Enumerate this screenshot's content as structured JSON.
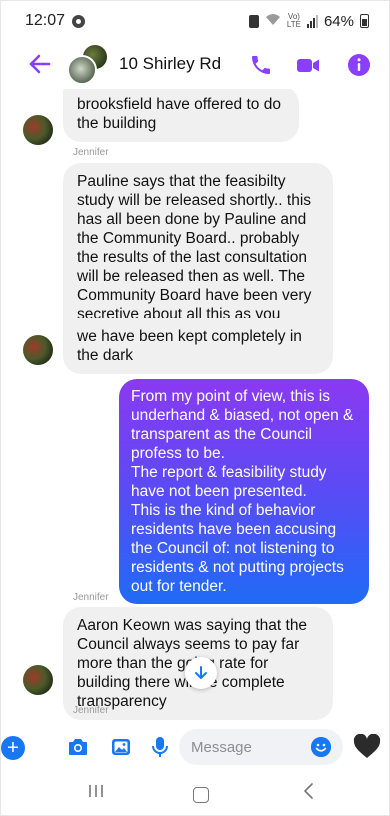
{
  "status_bar": {
    "time": "12:07",
    "lte_top": "Vo)",
    "lte_bottom": "LTE",
    "battery": "64%"
  },
  "header": {
    "title": "10 Shirley Rd",
    "back_icon": "arrow-left-icon",
    "actions": [
      "phone-icon",
      "video-icon",
      "info-icon"
    ],
    "accent_color": "#8a3ffc"
  },
  "messages": [
    {
      "id": "m1",
      "direction": "incoming",
      "text": "brooksfield have offered to do the building"
    },
    {
      "id": "m2",
      "direction": "incoming",
      "sender": "Jennifer",
      "text": "Pauline says that the feasibilty study will be released shortly.. this has all been done by Pauline and the Community Board.. probably the results of the last consultation will be released then as well. The Community Board have been very secretive about all this as you know?"
    },
    {
      "id": "m3",
      "direction": "incoming",
      "text": "we have been kept completely in the dark"
    },
    {
      "id": "m4",
      "direction": "outgoing",
      "lines": [
        "From my point of view, this is underhand & biased, not open & transparent as the Council profess to be.",
        "The report & feasibility study have not been presented.",
        "This is the kind of behavior residents have been accusing the Council of: not listening to residents & not putting projects out for tender."
      ]
    },
    {
      "id": "m5",
      "direction": "incoming",
      "sender": "Jennifer",
      "text": "Aaron Keown was saying that the Council always seems to pay far more than the going rate for building there will be complete transparency"
    },
    {
      "id": "m6",
      "sender": "Jennifer"
    }
  ],
  "composer": {
    "placeholder": "Message",
    "icons": [
      "plus-icon",
      "camera-icon",
      "image-icon",
      "microphone-icon",
      "emoji-icon",
      "heart-icon"
    ],
    "accent_color": "#1877f2"
  },
  "nav_bar": {
    "icons": [
      "recents-icon",
      "home-icon",
      "back-icon"
    ]
  }
}
